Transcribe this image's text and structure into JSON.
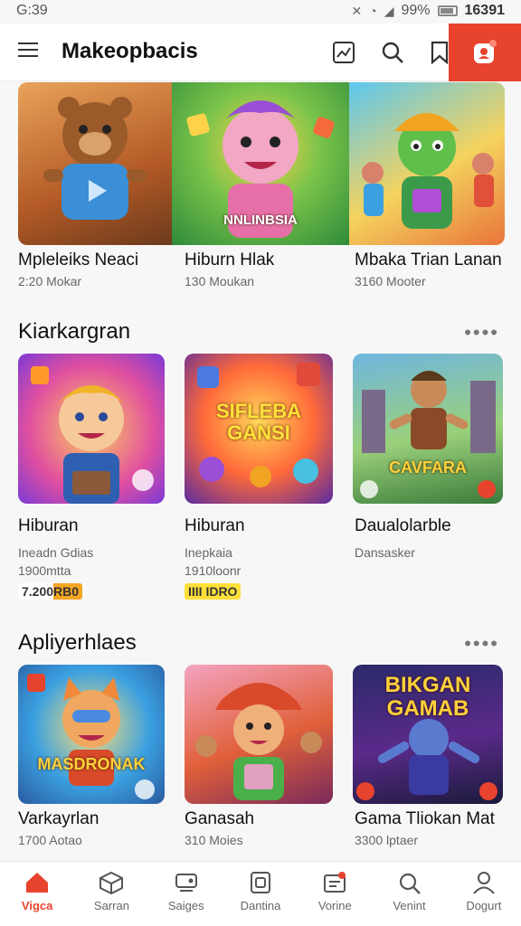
{
  "status": {
    "time": "G:39",
    "battery_pct": "99%",
    "clock_right": "16391"
  },
  "header": {
    "title": "Makeopbacis"
  },
  "featured": [
    {
      "title": "Mpleleiks Neaci",
      "sub": "2:20 Mokar",
      "art_text": ""
    },
    {
      "title": "Hiburn Hlak",
      "sub": "130 Moukan",
      "art_text": "NNLINBSIA"
    },
    {
      "title": "Mbaka Trian Lanan",
      "sub": "3160 Mooter",
      "art_text": ""
    }
  ],
  "section1": {
    "title": "Kiarkargran",
    "more_label": "••••",
    "items": [
      {
        "title": "Hiburan",
        "line1": "Ineadn Gdias",
        "line2": "1900mtta",
        "price": "7.200RB0",
        "art_text": ""
      },
      {
        "title": "Hiburan",
        "line1": "Inepkaia",
        "line2": "1910loonr",
        "price": "IIII IDRO",
        "art_text": "SIFLEBA GANSI"
      },
      {
        "title": "Daualolarble",
        "line1": "Dansasker",
        "line2": "",
        "price": "",
        "art_text": "CAVFARA"
      }
    ]
  },
  "section2": {
    "title": "Apliyerhlaes",
    "more_label": "••••",
    "items": [
      {
        "title": "Varkayrlan",
        "sub": "1700 Aotao",
        "art_text": "MASDRONAK"
      },
      {
        "title": "Ganasah",
        "sub": "310 Moies",
        "art_text": ""
      },
      {
        "title": "Gama Tliokan Mat",
        "sub": "3300 lptaer",
        "art_text": "BIKGAN GAMAB"
      }
    ]
  },
  "nav": [
    {
      "label": "Vigca",
      "icon": "home-icon"
    },
    {
      "label": "Sarran",
      "icon": "cube-icon"
    },
    {
      "label": "Saiges",
      "icon": "tag-icon"
    },
    {
      "label": "Dantina",
      "icon": "box-icon"
    },
    {
      "label": "Vorine",
      "icon": "inbox-icon"
    },
    {
      "label": "Venint",
      "icon": "search-icon"
    },
    {
      "label": "Dogurt",
      "icon": "user-icon"
    }
  ],
  "colors": {
    "accent": "#e8432d",
    "price_orange": "#f5a623",
    "price_yellow": "#ffe03a"
  }
}
